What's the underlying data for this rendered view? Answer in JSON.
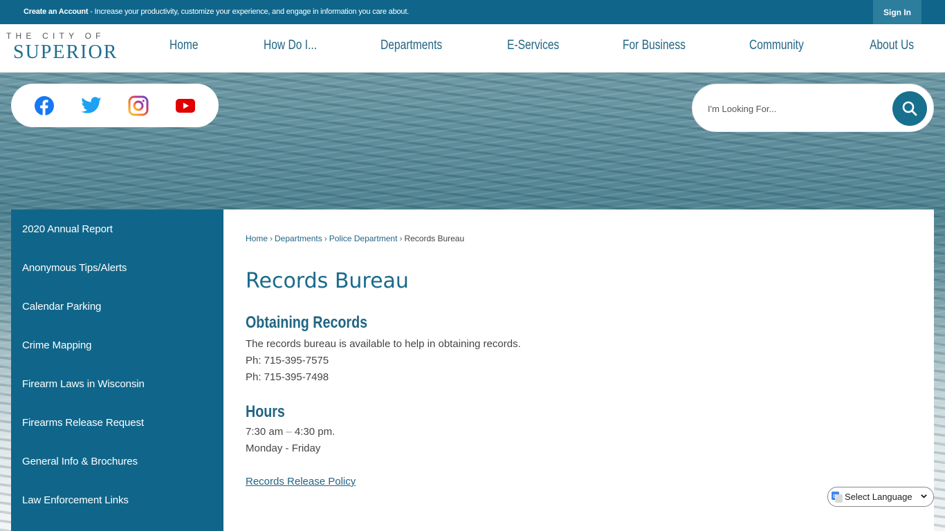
{
  "topbar": {
    "promo_bold": "Create an Account",
    "promo_text": " - Increase your productivity, customize your experience, and engage in information you care about.",
    "signin_label": "Sign In"
  },
  "logo": {
    "line1": "THE CITY OF",
    "line2": "SUPERIOR"
  },
  "nav": {
    "items": [
      {
        "label": "Home"
      },
      {
        "label": "How Do I..."
      },
      {
        "label": "Departments"
      },
      {
        "label": "E-Services"
      },
      {
        "label": "For Business"
      },
      {
        "label": "Community"
      },
      {
        "label": "About Us"
      }
    ]
  },
  "social": {
    "items": [
      {
        "name": "facebook-icon",
        "color": "#1877f2"
      },
      {
        "name": "twitter-icon",
        "color": "#1da1f2"
      },
      {
        "name": "instagram-icon",
        "color": "#c13584"
      },
      {
        "name": "youtube-icon",
        "color": "#e00000"
      }
    ]
  },
  "search": {
    "placeholder": "I'm Looking For...",
    "value": ""
  },
  "sidebar": {
    "items": [
      {
        "label": "2020 Annual Report"
      },
      {
        "label": "Anonymous Tips/Alerts"
      },
      {
        "label": "Calendar Parking"
      },
      {
        "label": "Crime Mapping"
      },
      {
        "label": "Firearm Laws in Wisconsin"
      },
      {
        "label": "Firearms Release Request"
      },
      {
        "label": "General Info & Brochures"
      },
      {
        "label": "Law Enforcement Links"
      }
    ]
  },
  "breadcrumb": {
    "items": [
      "Home",
      "Departments",
      "Police Department"
    ],
    "current": "Records Bureau",
    "separator": "›"
  },
  "content": {
    "title": "Records Bureau",
    "sections": [
      {
        "heading": "Obtaining Records",
        "lines": [
          "The records bureau is available to help in obtaining records.",
          "Ph: 715-395-7575",
          "Ph: 715-395-7498"
        ]
      },
      {
        "heading": "Hours",
        "hours_start": "7:30 am ",
        "hours_dash": "–",
        "hours_end": " 4:30 pm.",
        "days": "Monday - Friday"
      }
    ],
    "link": "Records Release Policy"
  },
  "language": {
    "selected": "Select Language"
  },
  "colors": {
    "primary": "#10668a",
    "accent": "#216584",
    "signin_bg": "#2d7d9d"
  }
}
